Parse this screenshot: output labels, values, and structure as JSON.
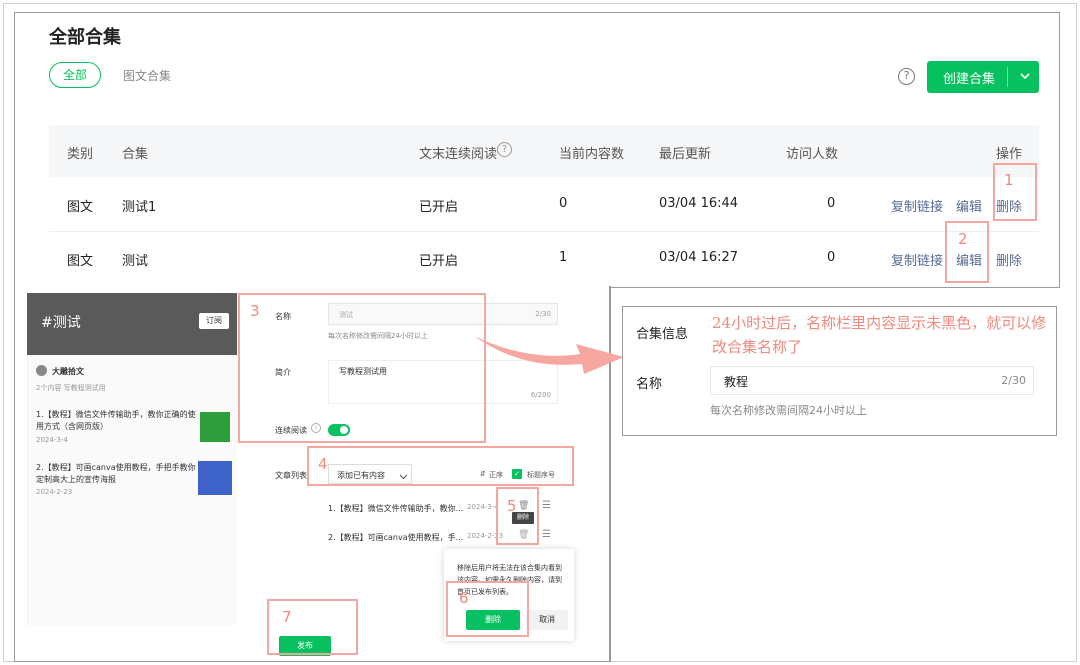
{
  "page": {
    "title": "全部合集",
    "tabs": {
      "all": "全部",
      "picture": "图文合集"
    },
    "help_icon": "?",
    "create_button": "创建合集"
  },
  "table": {
    "headers": [
      "类别",
      "合集",
      "文末连续阅读",
      "当前内容数",
      "最后更新",
      "访问人数",
      "操作"
    ],
    "rows": [
      {
        "category": "图文",
        "name": "测试1",
        "continuous": "已开启",
        "count": "0",
        "updated": "03/04 16:44",
        "visitors": "0",
        "copy": "复制链接",
        "edit": "编辑",
        "delete": "删除"
      },
      {
        "category": "图文",
        "name": "测试",
        "continuous": "已开启",
        "count": "1",
        "updated": "03/04 16:27",
        "visitors": "0",
        "copy": "复制链接",
        "edit": "编辑",
        "delete": "删除"
      }
    ]
  },
  "annotations": {
    "n1": "1",
    "n2": "2",
    "n3": "3",
    "n4": "4",
    "n5": "5",
    "n6": "6",
    "n7": "7"
  },
  "preview": {
    "tag": "#测试",
    "subscribe": "订阅",
    "author": "大雕拾文",
    "meta": "2个内容  写教程测试用",
    "articles": [
      {
        "title": "1.【教程】微信文件传输助手，教你正确的使用方式（含网页版）",
        "date": "2024-3-4"
      },
      {
        "title": "2.【教程】可画canva使用教程，手把手教你定制高大上的宣传海报",
        "date": "2024-2-23"
      }
    ]
  },
  "form": {
    "name_label": "名称",
    "name_value": "测试",
    "name_count": "2/30",
    "name_hint": "每次名称修改需间隔24小时以上",
    "intro_label": "简介",
    "intro_value": "写教程测试用",
    "intro_count": "6/200",
    "continuous_label": "连续阅读",
    "list_label": "文章列表",
    "add_existing": "添加已有内容",
    "order": "正序",
    "title_number": "标题序号",
    "list_items": [
      {
        "title": "1.【教程】微信文件传输助手，教你...",
        "date": "2024-3-4"
      },
      {
        "title": "2.【教程】可画canva使用教程，手...",
        "date": "2024-2-23"
      }
    ],
    "tooltip_delete": "删除",
    "popup_text": "移除后用户将无法在该合集内看到该内容。如需永久删除内容，请到首页已发布列表。",
    "popup_delete": "删除",
    "popup_cancel": "取消",
    "publish": "发布"
  },
  "info": {
    "note": "24小时过后，名称栏里内容显示未黑色，就可以修改合集名称了",
    "section_title": "合集信息",
    "name_label": "名称",
    "name_value": "教程",
    "name_count": "2/30",
    "hint": "每次名称修改需间隔24小时以上"
  }
}
